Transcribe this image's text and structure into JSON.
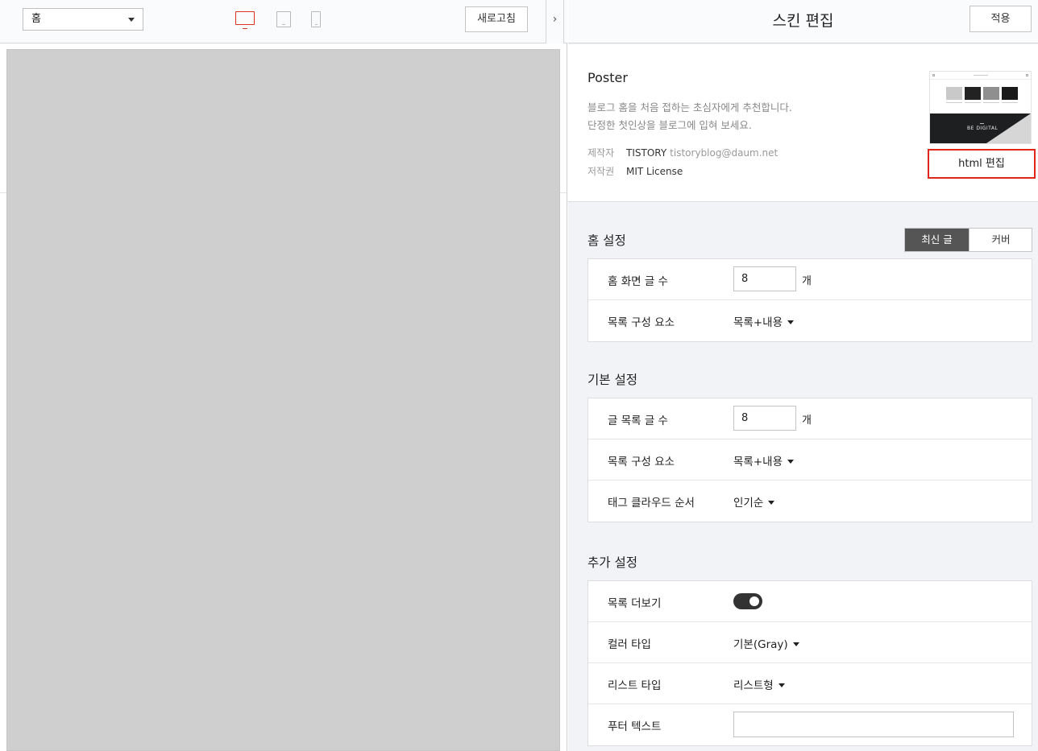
{
  "preview": {
    "page_select_value": "홈",
    "refresh_label": "새로고침",
    "collapse_glyph": "›",
    "device_active_color": "#e0301e"
  },
  "editor": {
    "title": "스킨 편집",
    "apply_label": "적용",
    "skin": {
      "name": "Poster",
      "desc_line1": "블로그 홈을 처음 접하는 초심자에게 추천합니다.",
      "desc_line2": "단정한 첫인상을 블로그에 입혀 보세요.",
      "author_key": "제작자",
      "author_name": "TISTORY",
      "author_email": "tistoryblog@daum.net",
      "license_key": "저작권",
      "license_value": "MIT License",
      "thumb_tag": "BE DIGITAL",
      "html_edit_label": "html 편집"
    },
    "home_settings": {
      "title": "홈 설정",
      "tabs": [
        "최신 글",
        "커버"
      ],
      "rows": [
        {
          "label": "홈 화면 글 수",
          "value": "8",
          "unit": "개"
        },
        {
          "label": "목록 구성 요소",
          "value": "목록+내용"
        }
      ]
    },
    "basic_settings": {
      "title": "기본 설정",
      "rows": [
        {
          "label": "글 목록 글 수",
          "value": "8",
          "unit": "개"
        },
        {
          "label": "목록 구성 요소",
          "value": "목록+내용"
        },
        {
          "label": "태그 클라우드 순서",
          "value": "인기순"
        }
      ]
    },
    "extra_settings": {
      "title": "추가 설정",
      "rows": [
        {
          "label": "목록 더보기",
          "toggle_on": true
        },
        {
          "label": "컬러 타입",
          "value": "기본(Gray)"
        },
        {
          "label": "리스트 타입",
          "value": "리스트형"
        },
        {
          "label": "푸터 텍스트",
          "value": ""
        }
      ]
    }
  }
}
